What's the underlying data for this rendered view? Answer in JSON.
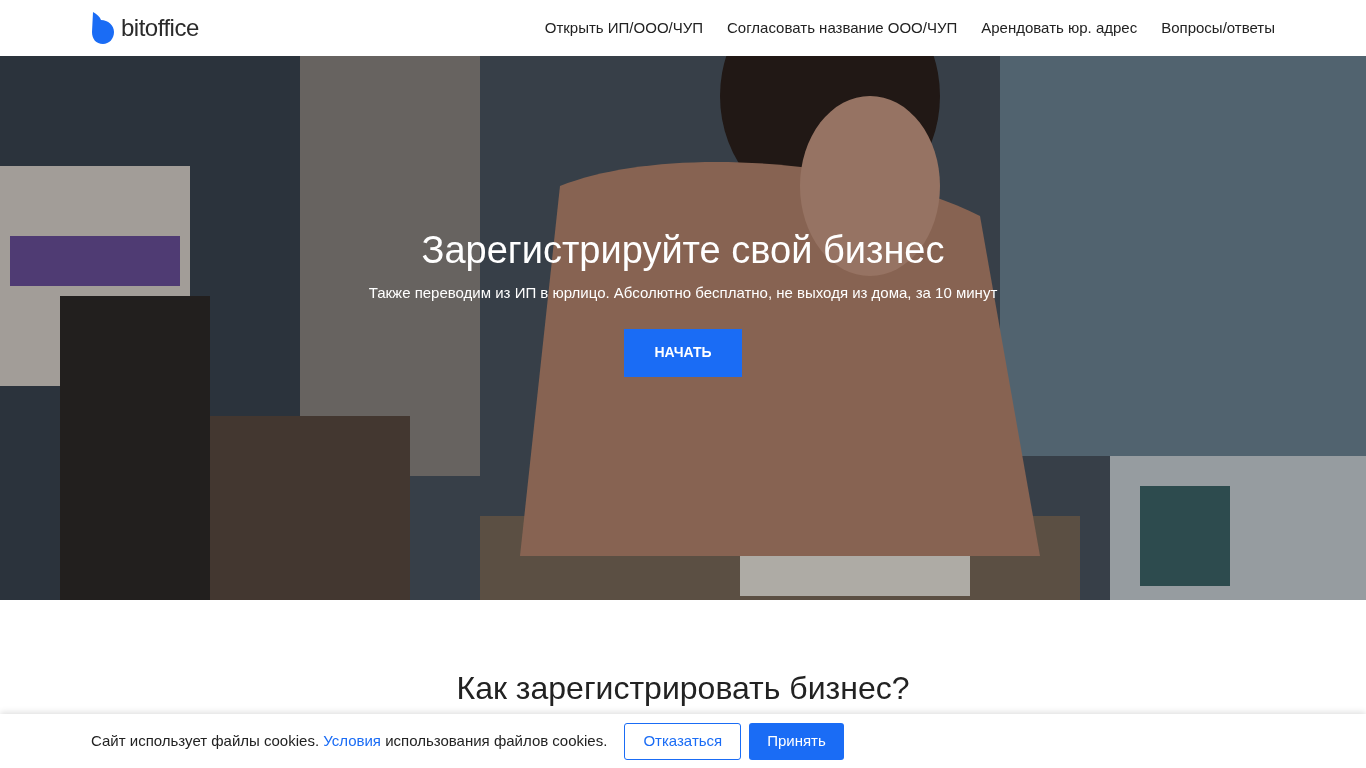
{
  "header": {
    "logo": "bitoffice",
    "nav": [
      {
        "label": "Открыть ИП/ООО/ЧУП"
      },
      {
        "label": "Согласовать название ООО/ЧУП"
      },
      {
        "label": "Арендовать юр. адрес"
      },
      {
        "label": "Вопросы/ответы"
      }
    ]
  },
  "hero": {
    "title": "Зарегистрируйте свой бизнес",
    "subtitle": "Также переводим из ИП в юрлицо. Абсолютно бесплатно, не выходя из дома, за 10 минут",
    "button": "НАЧАТЬ"
  },
  "section": {
    "title": "Как зарегистрировать бизнес?"
  },
  "cookie_bar": {
    "text_before": "Сайт использует файлы cookies.",
    "link": "Условия",
    "text_after": "использования файлов cookies.",
    "buttons": [
      {
        "label": "Отказаться",
        "kind": "outline"
      },
      {
        "label": "Принять",
        "kind": "primary"
      }
    ]
  }
}
